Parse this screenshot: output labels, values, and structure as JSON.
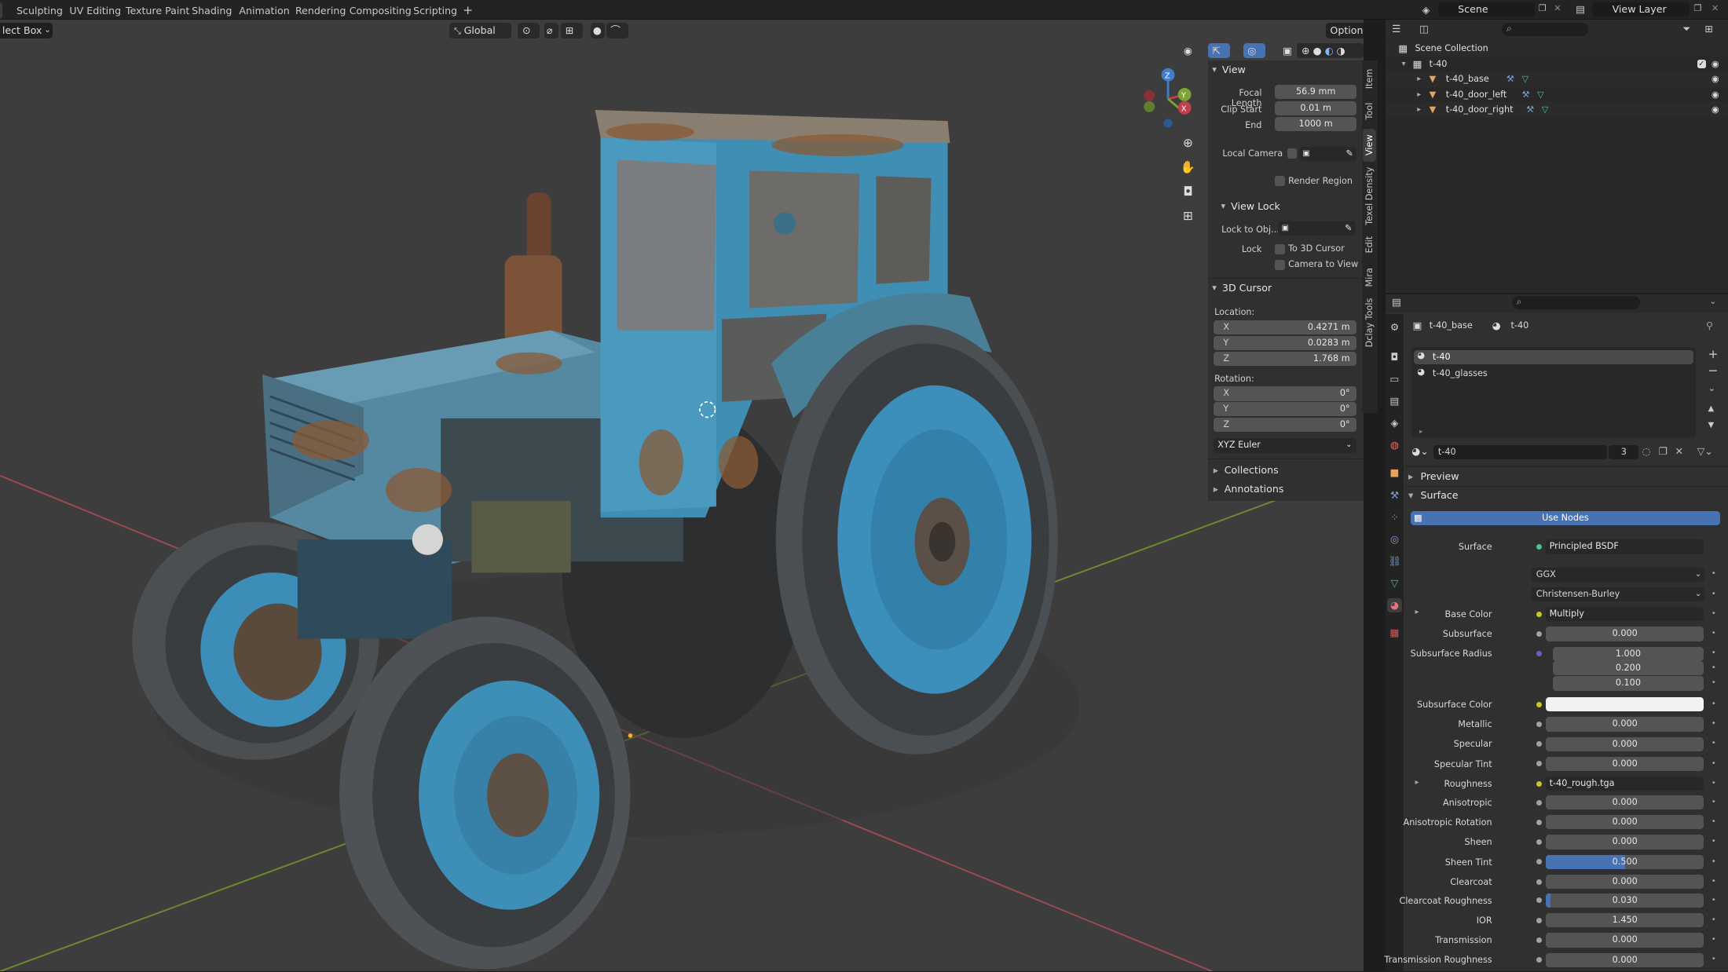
{
  "workspace_tabs": [
    "Sculpting",
    "UV Editing",
    "Texture Paint",
    "Shading",
    "Animation",
    "Rendering",
    "Compositing",
    "Scripting"
  ],
  "add_tab": "+",
  "scene": {
    "name": "Scene"
  },
  "view_layer": {
    "name": "View Layer"
  },
  "viewport": {
    "select_mode": "lect Box",
    "orientation": "Global",
    "options": "Options",
    "gizmo_axes": {
      "x": "X",
      "y": "Y",
      "z": "Z"
    }
  },
  "npanel": {
    "view": {
      "title": "View",
      "focal_length_label": "Focal Length",
      "focal_length": "56.9 mm",
      "clip_start_label": "Clip Start",
      "clip_start": "0.01 m",
      "end_label": "End",
      "end": "1000 m",
      "local_camera_label": "Local Camera",
      "render_region": "Render Region",
      "view_lock_title": "View Lock",
      "lock_to_obj_label": "Lock to Obj...",
      "lock_label": "Lock",
      "to_3d_cursor": "To 3D Cursor",
      "camera_to_view": "Camera to View"
    },
    "cursor": {
      "title": "3D Cursor",
      "location_label": "Location:",
      "x": "0.4271 m",
      "y": "0.0283 m",
      "z": "1.768 m",
      "rotation_label": "Rotation:",
      "rx": "0°",
      "ry": "0°",
      "rz": "0°",
      "mode": "XYZ Euler",
      "axis_x": "X",
      "axis_y": "Y",
      "axis_z": "Z"
    },
    "collections": "Collections",
    "annotations": "Annotations",
    "side_tabs": [
      "Item",
      "Tool",
      "View",
      "Texel Density",
      "Edit",
      "Mira",
      "Dclay Tools"
    ],
    "active_side_tab": "View"
  },
  "outliner": {
    "root": "Scene Collection",
    "collection": "t-40",
    "objects": [
      "t-40_base",
      "t-40_door_left",
      "t-40_door_right"
    ]
  },
  "properties": {
    "object": "t-40_base",
    "material_name": "t-40",
    "slots": [
      "t-40",
      "t-40_glasses"
    ],
    "material_field": "t-40",
    "users": "3",
    "preview": "Preview",
    "surface_panel": "Surface",
    "use_nodes": "Use Nodes",
    "surface_label": "Surface",
    "surface_shader": "Principled BSDF",
    "distribution": "GGX",
    "subsurface_method": "Christensen-Burley",
    "inputs": [
      {
        "label": "Base Color",
        "value": "Multiply",
        "kind": "link",
        "socket": "#c7c729",
        "expand": true
      },
      {
        "label": "Subsurface",
        "value": "0.000",
        "kind": "num",
        "socket": "#a1a1a1"
      },
      {
        "label": "Subsurface Radius",
        "value": "1.000",
        "kind": "num",
        "socket": "#6363c7"
      },
      {
        "label": "",
        "value": "0.200",
        "kind": "num",
        "socket": ""
      },
      {
        "label": "",
        "value": "0.100",
        "kind": "num",
        "socket": ""
      },
      {
        "label": "Subsurface Color",
        "value": "",
        "kind": "color",
        "socket": "#c7c729"
      },
      {
        "label": "Metallic",
        "value": "0.000",
        "kind": "num",
        "socket": "#a1a1a1"
      },
      {
        "label": "Specular",
        "value": "0.000",
        "kind": "num",
        "socket": "#a1a1a1"
      },
      {
        "label": "Specular Tint",
        "value": "0.000",
        "kind": "num",
        "socket": "#a1a1a1"
      },
      {
        "label": "Roughness",
        "value": "t-40_rough.tga",
        "kind": "link",
        "socket": "#c7c729",
        "expand": true
      },
      {
        "label": "Anisotropic",
        "value": "0.000",
        "kind": "num",
        "socket": "#a1a1a1"
      },
      {
        "label": "Anisotropic Rotation",
        "value": "0.000",
        "kind": "num",
        "socket": "#a1a1a1"
      },
      {
        "label": "Sheen",
        "value": "0.000",
        "kind": "num",
        "socket": "#a1a1a1"
      },
      {
        "label": "Sheen Tint",
        "value": "0.500",
        "kind": "num",
        "socket": "#a1a1a1",
        "fill": 0.5
      },
      {
        "label": "Clearcoat",
        "value": "0.000",
        "kind": "num",
        "socket": "#a1a1a1"
      },
      {
        "label": "Clearcoat Roughness",
        "value": "0.030",
        "kind": "num",
        "socket": "#a1a1a1",
        "fill": 0.03
      },
      {
        "label": "IOR",
        "value": "1.450",
        "kind": "num",
        "socket": "#a1a1a1"
      },
      {
        "label": "Transmission",
        "value": "0.000",
        "kind": "num",
        "socket": "#a1a1a1"
      },
      {
        "label": "Transmission Roughness",
        "value": "0.000",
        "kind": "num",
        "socket": "#a1a1a1"
      }
    ]
  },
  "colors": {
    "accent": "#4772b3",
    "tractor_blue": "#3f8fb5",
    "rust": "#7a4a2a",
    "x_axis": "#c2404d",
    "y_axis": "#7ca434",
    "z_axis": "#3f7dce"
  }
}
